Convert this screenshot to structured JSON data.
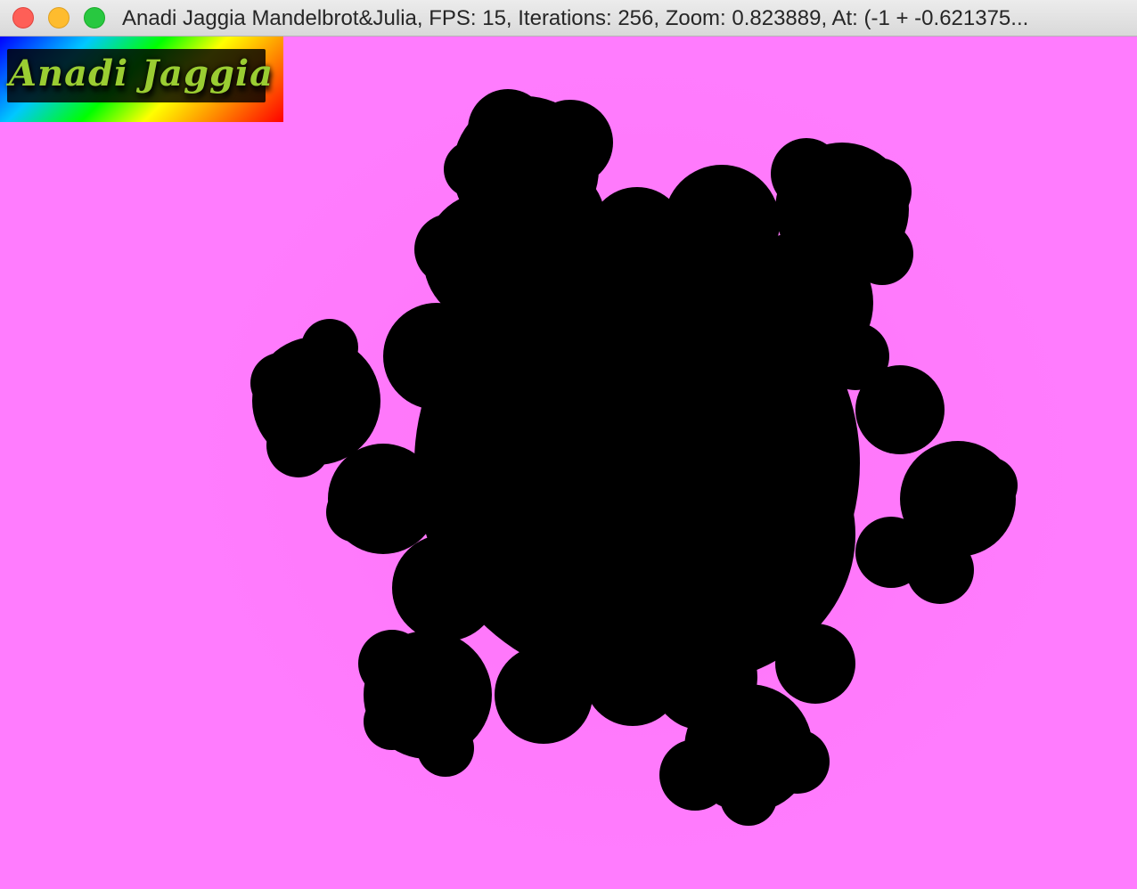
{
  "window": {
    "title": "Anadi Jaggia Mandelbrot&Julia, FPS: 15, Iterations: 256, Zoom: 0.823889, At: (-1 + -0.621375...",
    "controls": {
      "close": "close-button",
      "minimize": "minimize-button",
      "maximize": "zoom-button"
    }
  },
  "logo": {
    "text": "Anadi Jaggia"
  },
  "render": {
    "fps": 15,
    "iterations": 256,
    "zoom": 0.823889,
    "background_color": "#ff7cfe",
    "set_color": "#000000"
  }
}
